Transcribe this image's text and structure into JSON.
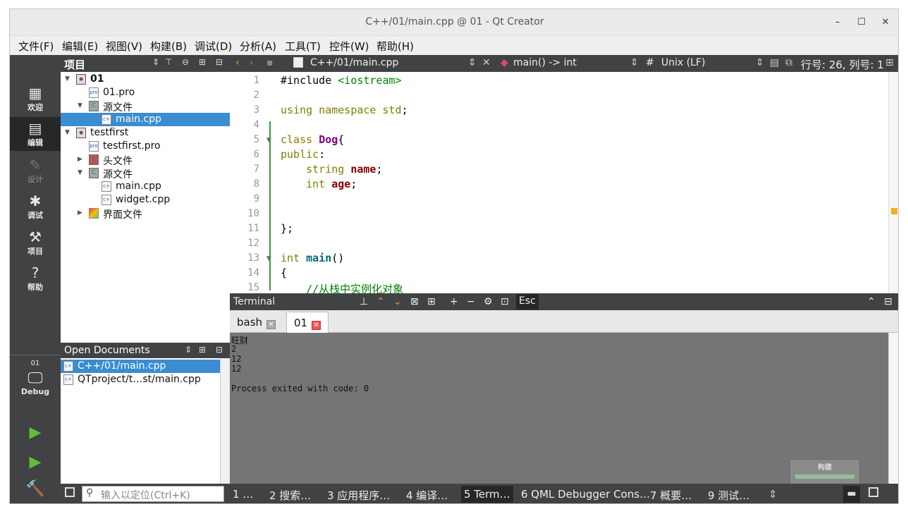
{
  "window": {
    "title": "C++/01/main.cpp @ 01 - Qt Creator",
    "minimize": "–",
    "maximize": "☐",
    "close": "✕"
  },
  "menu": [
    "文件(F)",
    "编辑(E)",
    "视图(V)",
    "构建(B)",
    "调试(D)",
    "分析(A)",
    "工具(T)",
    "控件(W)",
    "帮助(H)"
  ],
  "modes": [
    {
      "label": "欢迎",
      "icon": "grid-icon"
    },
    {
      "label": "编辑",
      "icon": "document-icon"
    },
    {
      "label": "设计",
      "icon": "pencil-icon"
    },
    {
      "label": "调试",
      "icon": "bug-icon"
    },
    {
      "label": "项目",
      "icon": "wrench-icon"
    },
    {
      "label": "帮助",
      "icon": "help-icon"
    }
  ],
  "target": {
    "project": "01",
    "config": "Debug"
  },
  "project_panel": {
    "title": "项目",
    "tree": [
      {
        "label": "01",
        "kind": "project",
        "bold": true
      },
      {
        "label": "01.pro",
        "kind": "pro"
      },
      {
        "label": "源文件",
        "kind": "folder"
      },
      {
        "label": "main.cpp",
        "kind": "cpp",
        "selected": true
      },
      {
        "label": "testfirst",
        "kind": "project"
      },
      {
        "label": "testfirst.pro",
        "kind": "pro"
      },
      {
        "label": "头文件",
        "kind": "folder"
      },
      {
        "label": "源文件",
        "kind": "folder"
      },
      {
        "label": "main.cpp",
        "kind": "cpp"
      },
      {
        "label": "widget.cpp",
        "kind": "cpp"
      },
      {
        "label": "界面文件",
        "kind": "ui"
      }
    ]
  },
  "open_documents": {
    "title": "Open Documents",
    "items": [
      "C++/01/main.cpp",
      "QTproject/t…st/main.cpp"
    ]
  },
  "editor_toolbar": {
    "file": "C++/01/main.cpp",
    "symbol": "main() -> int",
    "hash": "#",
    "line_ending": "Unix (LF)",
    "position": "行号: 26, 列号: 1"
  },
  "code_lines": [
    {
      "n": "1",
      "text": "#include <iostream>"
    },
    {
      "n": "2",
      "text": ""
    },
    {
      "n": "3",
      "text": "using namespace std;"
    },
    {
      "n": "4",
      "text": ""
    },
    {
      "n": "5",
      "text": "class Dog{"
    },
    {
      "n": "6",
      "text": "public:"
    },
    {
      "n": "7",
      "text": "    string name;"
    },
    {
      "n": "8",
      "text": "    int age;"
    },
    {
      "n": "9",
      "text": ""
    },
    {
      "n": "10",
      "text": ""
    },
    {
      "n": "11",
      "text": "};"
    },
    {
      "n": "12",
      "text": ""
    },
    {
      "n": "13",
      "text": "int main()"
    },
    {
      "n": "14",
      "text": "{"
    },
    {
      "n": "15",
      "text": "    //从栈中实例化对象"
    }
  ],
  "terminal": {
    "title": "Terminal",
    "esc": "Esc",
    "tabs": [
      {
        "label": "bash"
      },
      {
        "label": "01"
      }
    ],
    "output": [
      "旺财",
      "2",
      "12",
      "12",
      "",
      "Process exited with code: 0"
    ],
    "build_label": "构建"
  },
  "statusbar": {
    "locator_placeholder": "输入以定位(Ctrl+K)",
    "tabs": [
      "1 …",
      "2 搜索…",
      "3 应用程序…",
      "4 编译…",
      "5 Term…",
      "6 QML Debugger Cons…",
      "7 概要…",
      "9 测试…"
    ]
  },
  "colors": {
    "sidebar": "#404244",
    "selection": "#3a8dd0",
    "terminal_bg": "#757575"
  }
}
